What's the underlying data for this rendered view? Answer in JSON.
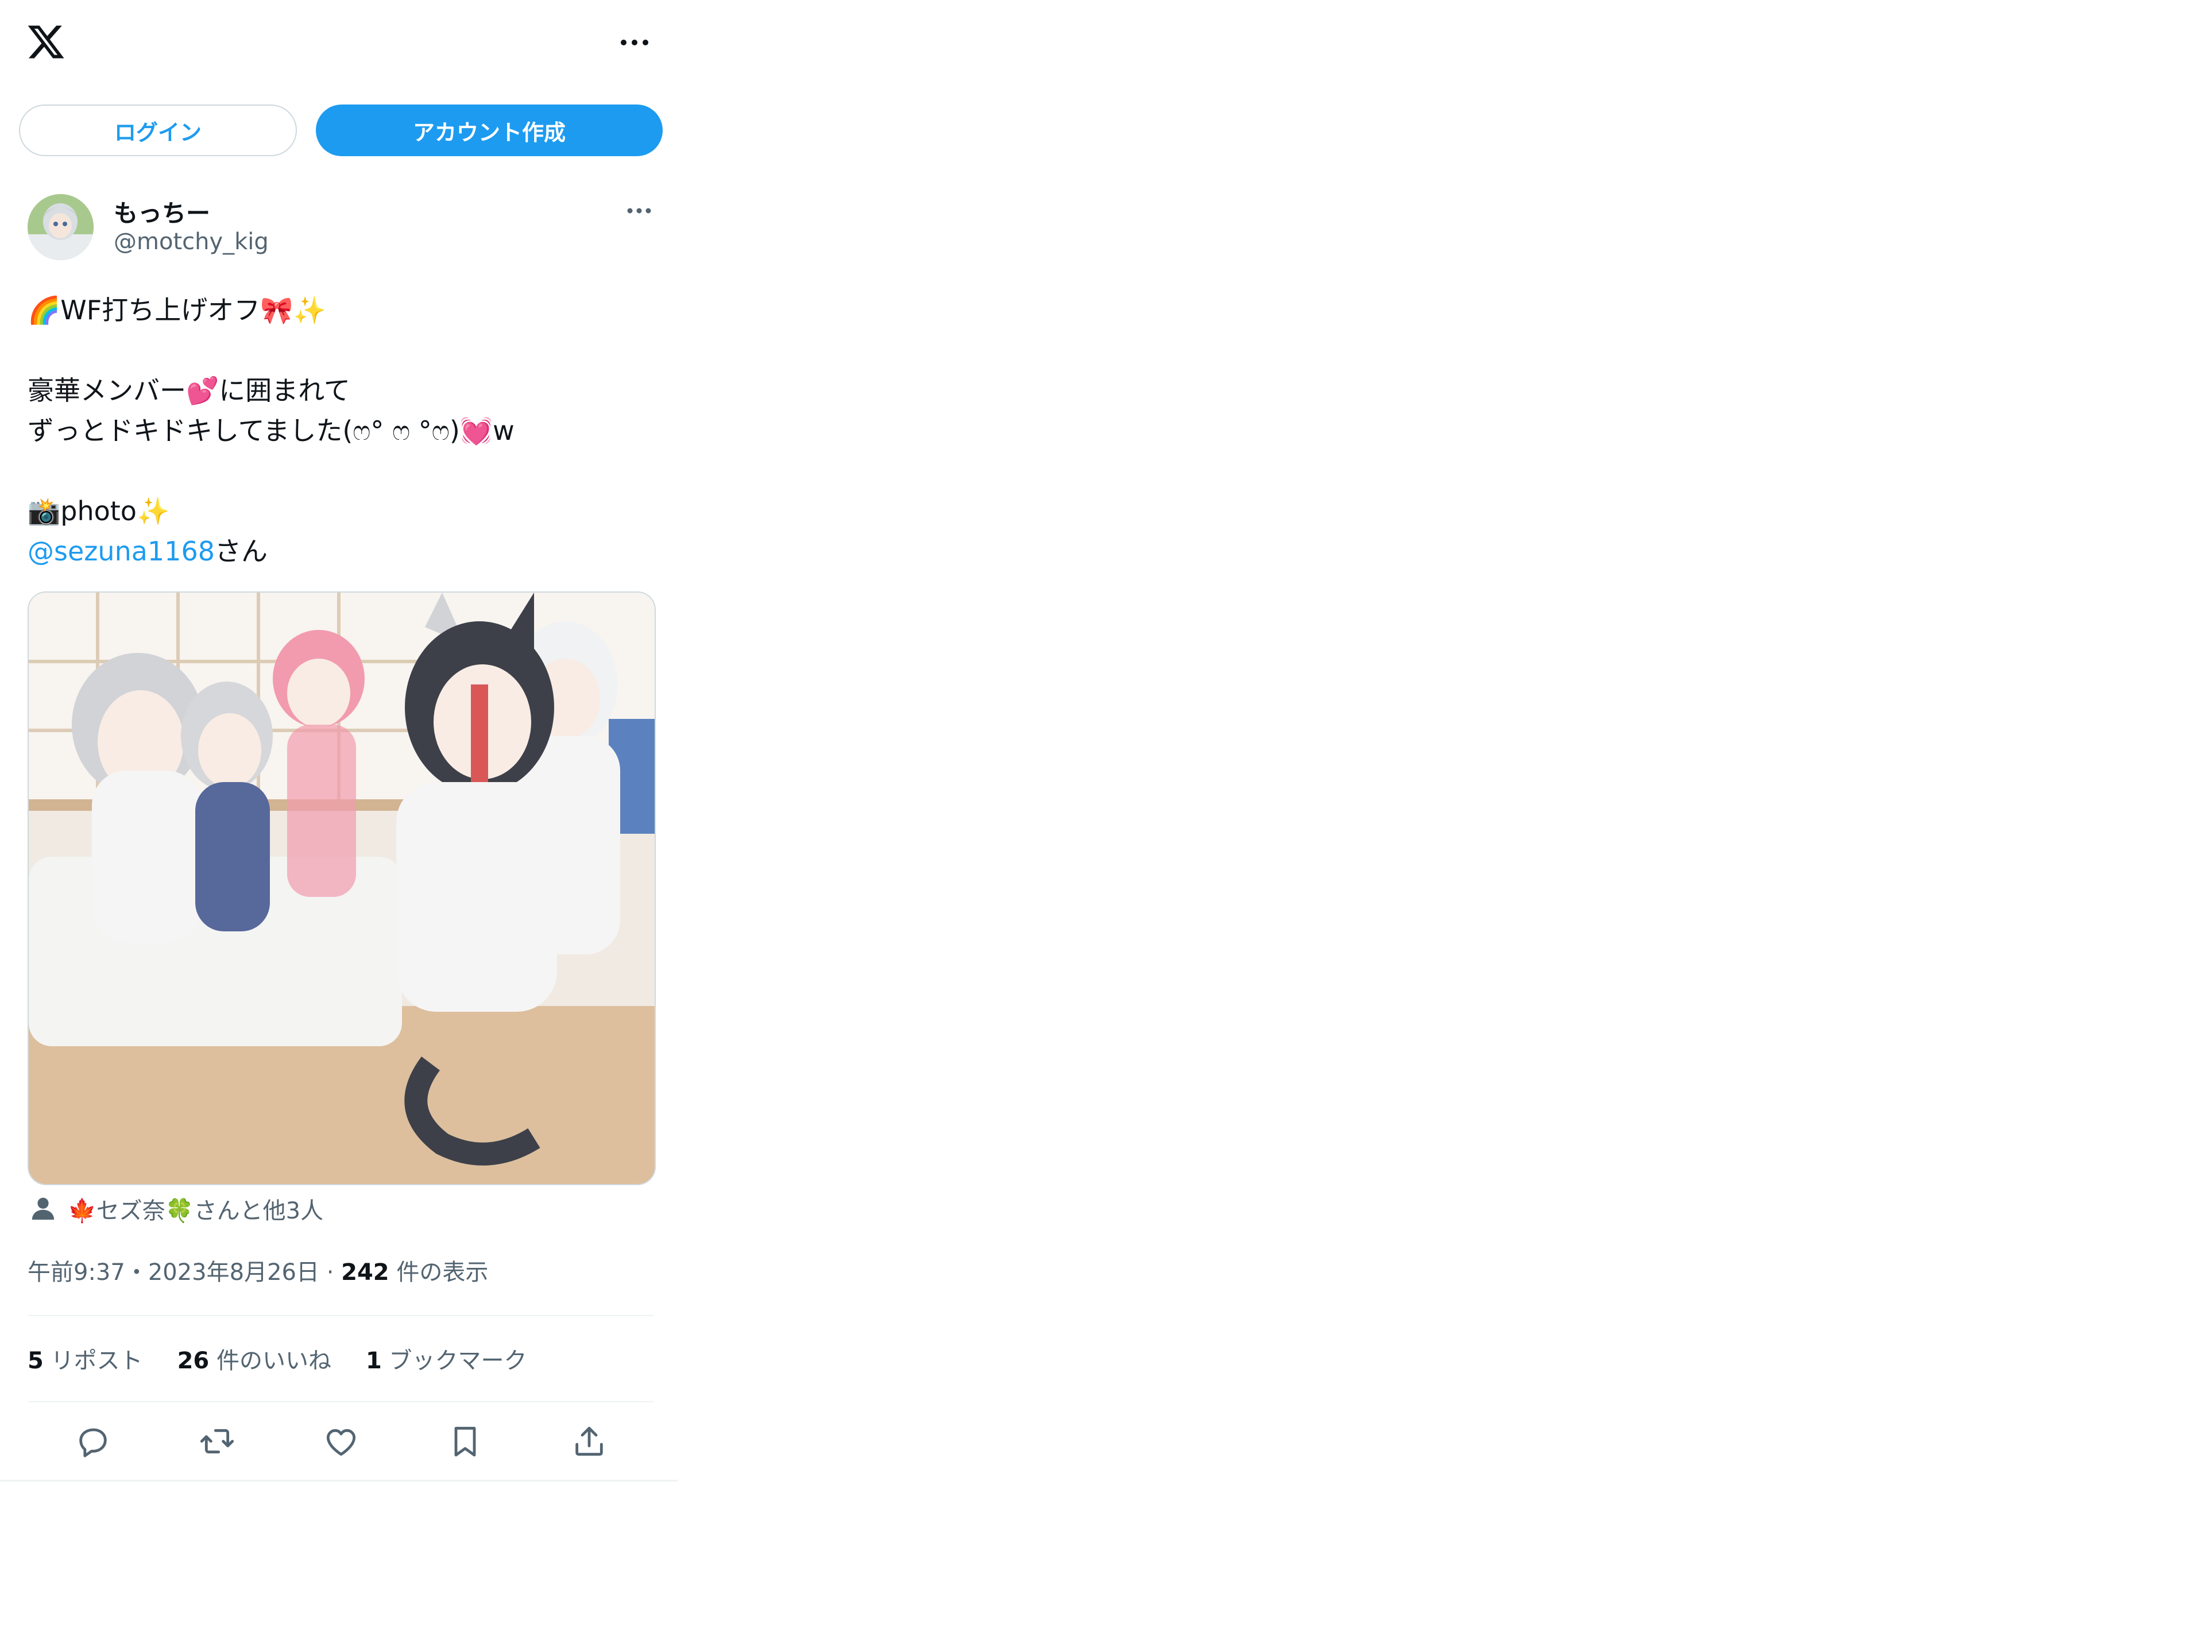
{
  "header": {
    "logo_icon": "x-logo-icon",
    "more_icon": "more-horizontal-icon"
  },
  "auth": {
    "login_label": "ログイン",
    "signup_label": "アカウント作成",
    "accent_color": "#1d9bf0"
  },
  "tweet": {
    "author": {
      "display_name": "もっちー",
      "handle": "@motchy_kig"
    },
    "text": {
      "line1": "🌈WF打ち上げオフ🎀✨",
      "line2": "豪華メンバー💕に囲まれて",
      "line3": "ずっとドキドキしてました(ෆ° ෆ °ෆ)💓w",
      "line4": "📸photo✨",
      "mention": "@sezuna1168",
      "mention_suffix": "さん"
    },
    "tagged": "🍁セズ奈🍀さんと他3人",
    "meta": {
      "time": "午前9:37",
      "separator": "・",
      "date": "2023年8月26日",
      "separator2": " · ",
      "views_count": "242",
      "views_label": " 件の表示"
    },
    "stats": {
      "reposts_count": "5",
      "reposts_label": " リポスト",
      "likes_count": "26",
      "likes_label": " 件のいいね",
      "bookmarks_count": "1",
      "bookmarks_label": " ブックマーク"
    },
    "actions": [
      "reply-icon",
      "repost-icon",
      "like-icon",
      "bookmark-icon",
      "share-icon"
    ]
  }
}
